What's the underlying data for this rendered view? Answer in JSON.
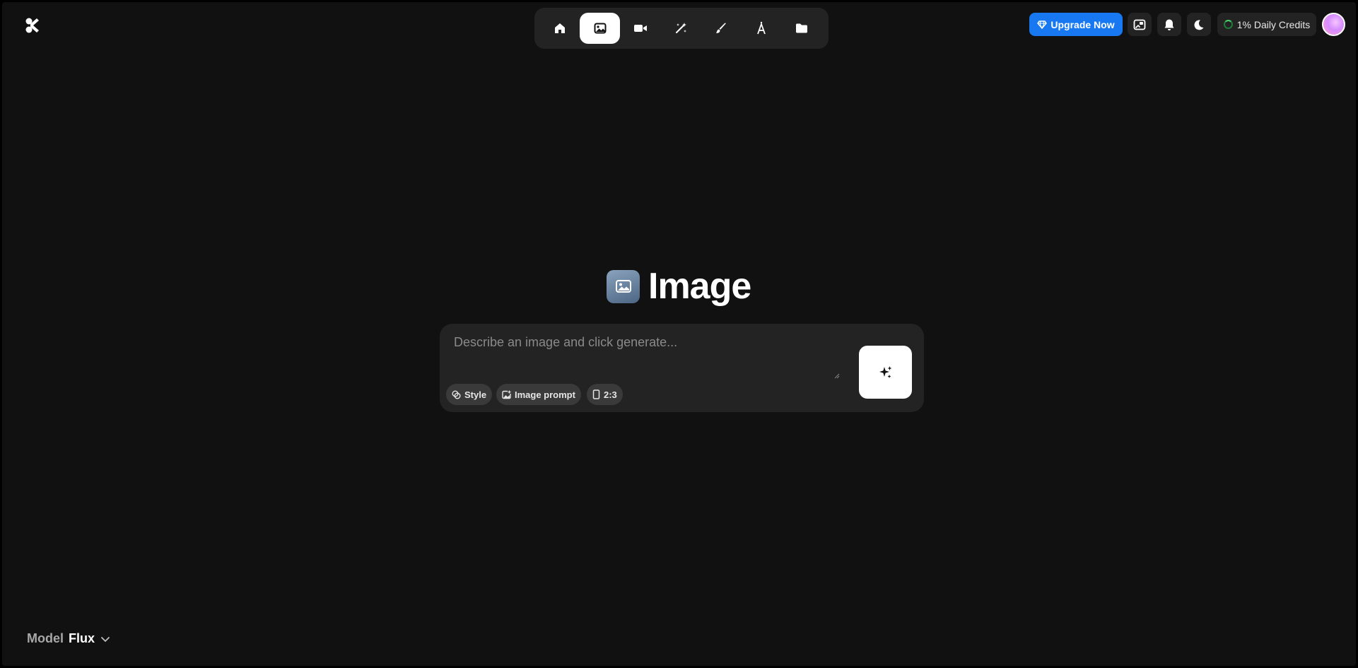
{
  "colors": {
    "background": "#111111",
    "panel": "#232323",
    "accent": "#1778f2",
    "chip": "#3a3a3a",
    "text": "#ffffff"
  },
  "topnav": {
    "items": [
      {
        "name": "home",
        "icon": "home-icon",
        "active": false
      },
      {
        "name": "image",
        "icon": "image-icon",
        "active": true
      },
      {
        "name": "video",
        "icon": "video-camera-icon",
        "active": false
      },
      {
        "name": "enhance",
        "icon": "magic-wand-icon",
        "active": false
      },
      {
        "name": "edit",
        "icon": "brush-icon",
        "active": false
      },
      {
        "name": "text",
        "icon": "type-icon",
        "active": false
      },
      {
        "name": "assets",
        "icon": "folder-icon",
        "active": false
      }
    ]
  },
  "header": {
    "upgrade_label": "Upgrade Now",
    "credits_label": "1% Daily Credits"
  },
  "hero": {
    "title": "Image"
  },
  "prompt": {
    "placeholder": "Describe an image and click generate...",
    "value": "",
    "chips": [
      {
        "label": "Style",
        "icon": "style-icon"
      },
      {
        "label": "Image prompt",
        "icon": "image-prompt-icon"
      },
      {
        "label": "2:3",
        "icon": "aspect-ratio-icon"
      }
    ]
  },
  "model": {
    "label": "Model",
    "value": "Flux"
  }
}
